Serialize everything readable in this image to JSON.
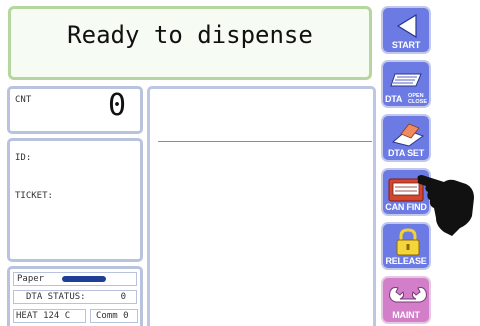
{
  "status": {
    "message": "Ready to dispense"
  },
  "counter": {
    "label": "CNT",
    "value": "0"
  },
  "ticket_info": {
    "id_label": "ID:",
    "ticket_label": "TICKET:"
  },
  "status_panel": {
    "paper_label": "Paper",
    "dta_status_label": "DTA STATUS:",
    "dta_status_value": "0",
    "heat": "HEAT 124  C",
    "comm": "Comm 0"
  },
  "buttons": {
    "start": {
      "label": "START",
      "icon": "left-arrow-icon"
    },
    "dta_open_close": {
      "label": "DTA",
      "sub_top": "OPEN",
      "sub_bottom": "CLOSE",
      "icon": "dta-tray-icon"
    },
    "dta_set": {
      "label": "DTA SET",
      "icon": "dta-set-icon"
    },
    "can_find": {
      "label": "CAN FIND",
      "icon": "can-find-icon"
    },
    "release": {
      "label": "RELEASE",
      "icon": "padlock-icon"
    },
    "maint": {
      "label": "MAINT",
      "icon": "wrench-icon"
    }
  },
  "colors": {
    "button_blue": "#6c7be4",
    "button_maint": "#d27ec8",
    "status_border": "#b5d79f",
    "panel_border": "#b9c3de",
    "paper_bar": "#1f3f96"
  },
  "pointer": {
    "icon": "pointing-hand-icon"
  }
}
